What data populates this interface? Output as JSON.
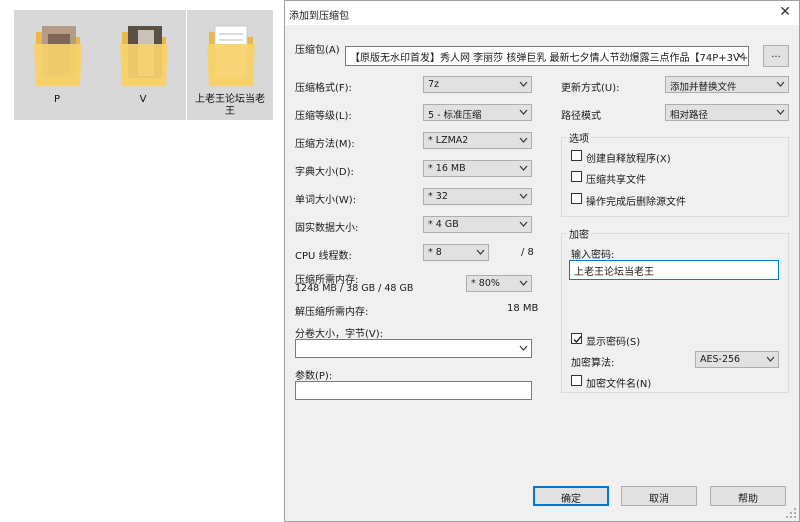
{
  "desktop": {
    "folders": [
      {
        "name": "P"
      },
      {
        "name": "V"
      },
      {
        "name": "上老王论坛当老王"
      }
    ]
  },
  "dialog": {
    "title": "添加到压缩包",
    "close_glyph": "✕",
    "archive": {
      "label": "压缩包(A)",
      "value": "【原版无水印首发】秀人网 李丽莎 核弹巨乳 最新七夕情人节劲爆露三点作品【74P+3V+3",
      "browse_label": "..."
    },
    "left": {
      "format": {
        "label": "压缩格式(F):",
        "value": "7z"
      },
      "level": {
        "label": "压缩等级(L):",
        "value": "5 - 标准压缩"
      },
      "method": {
        "label": "压缩方法(M):",
        "value": "* LZMA2"
      },
      "dict": {
        "label": "字典大小(D):",
        "value": "* 16 MB"
      },
      "word": {
        "label": "单词大小(W):",
        "value": "* 32"
      },
      "solid": {
        "label": "固实数据大小:",
        "value": "* 4 GB"
      },
      "threads": {
        "label": "CPU 线程数:",
        "value": "* 8",
        "max": "/ 8"
      },
      "memory": {
        "label": "压缩所需内存:",
        "detail": "1248 MB / 38 GB / 48 GB",
        "value": "* 80%"
      },
      "decomp": {
        "label": "解压缩所需内存:",
        "value": "18 MB"
      },
      "volume": {
        "label": "分卷大小，字节(V):",
        "value": ""
      },
      "params": {
        "label": "参数(P):",
        "value": ""
      }
    },
    "right": {
      "update": {
        "label": "更新方式(U):",
        "value": "添加并替换文件"
      },
      "path": {
        "label": "路径模式",
        "value": "相对路径"
      },
      "options": {
        "title": "选项",
        "sfx": "创建自释放程序(X)",
        "shared": "压缩共享文件",
        "delete": "操作完成后删除源文件"
      },
      "encryption": {
        "title": "加密",
        "password_label": "输入密码:",
        "password_value": "上老王论坛当老王",
        "show_password": "显示密码(S)",
        "algo_label": "加密算法:",
        "algo_value": "AES-256",
        "encrypt_names": "加密文件名(N)"
      }
    },
    "buttons": {
      "ok": "确定",
      "cancel": "取消",
      "help": "帮助"
    }
  }
}
